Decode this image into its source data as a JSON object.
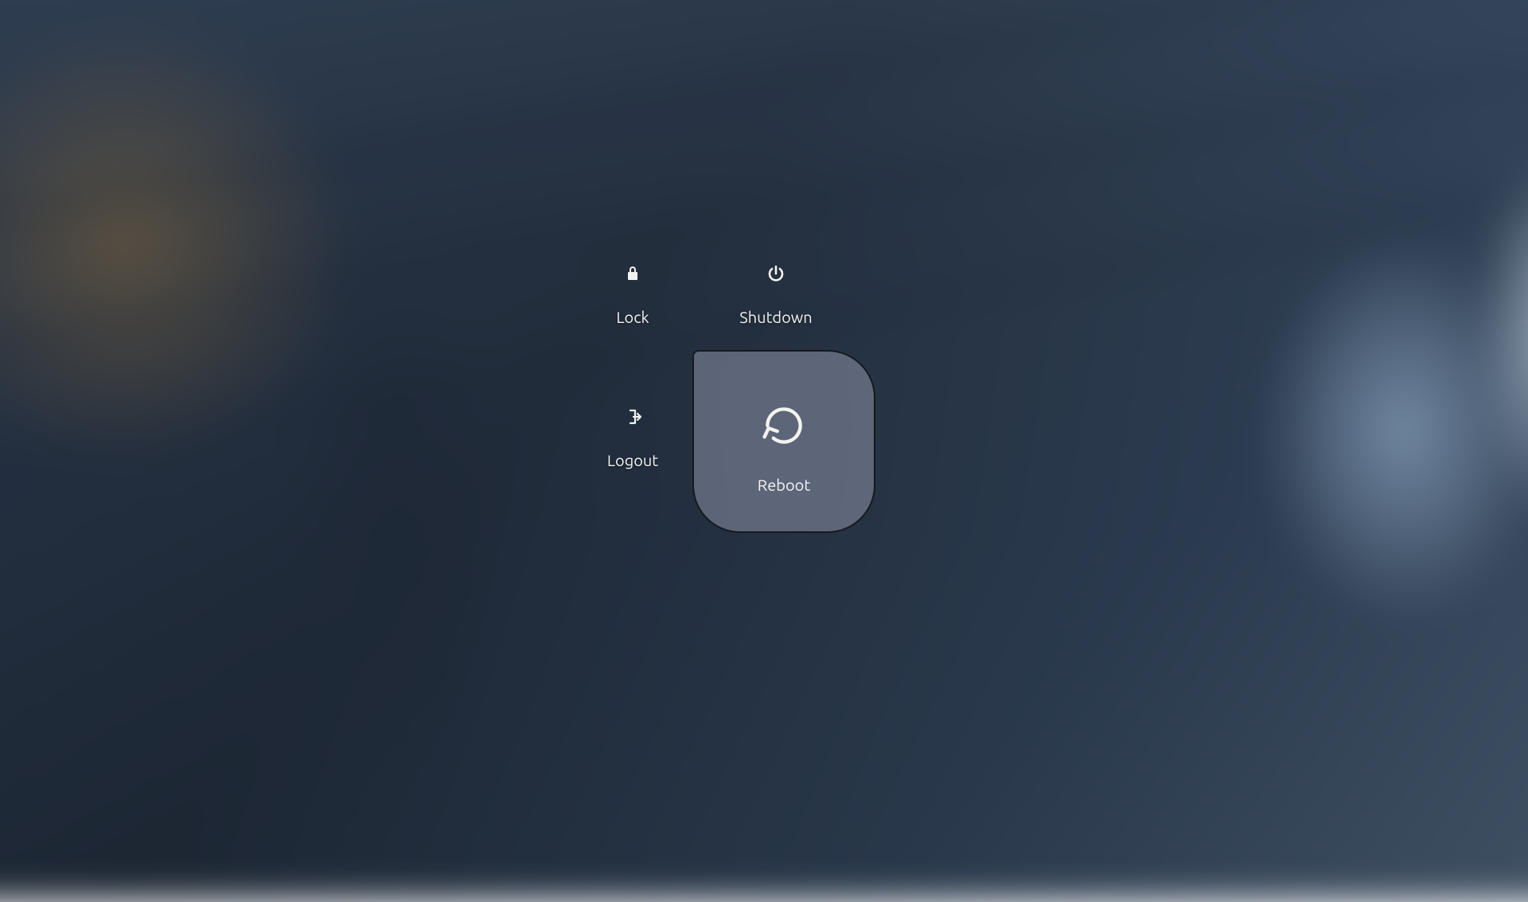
{
  "power_menu": {
    "selected": "reboot",
    "items": {
      "lock": {
        "label": "Lock",
        "icon": "lock-icon"
      },
      "shutdown": {
        "label": "Shutdown",
        "icon": "power-icon"
      },
      "logout": {
        "label": "Logout",
        "icon": "logout-icon"
      },
      "reboot": {
        "label": "Reboot",
        "icon": "reboot-icon"
      }
    }
  },
  "colors": {
    "text": "#f2f2f0",
    "selected_bg": "rgba(140,145,165,0.55)",
    "selected_border": "rgba(10,10,15,0.85)"
  }
}
